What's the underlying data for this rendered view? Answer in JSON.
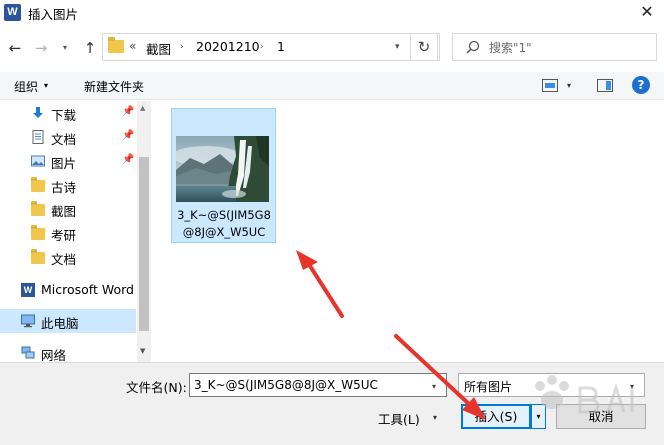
{
  "window": {
    "app_icon_letter": "W",
    "title": "插入图片",
    "close_glyph": "✕"
  },
  "navigation": {
    "back_glyph": "←",
    "forward_glyph": "→",
    "recent_glyph": "▾",
    "up_glyph": "↑",
    "breadcrumb_overflow": "«",
    "breadcrumbs": [
      "截图",
      "20201210",
      "1"
    ],
    "separator": "›",
    "refresh_glyph": "↻",
    "search_placeholder": "搜索\"1\""
  },
  "toolbar": {
    "organize_label": "组织",
    "organize_arrow": "▾",
    "new_folder_label": "新建文件夹",
    "view_arrow": "▾",
    "help_glyph": "?"
  },
  "sidebar": {
    "pin_glyph": "📌",
    "items": [
      {
        "label": "下载",
        "icon": "download-icon",
        "pinned": true
      },
      {
        "label": "文档",
        "icon": "document-icon",
        "pinned": true
      },
      {
        "label": "图片",
        "icon": "pictures-icon",
        "pinned": true
      },
      {
        "label": "古诗",
        "icon": "folder-icon",
        "pinned": false
      },
      {
        "label": "截图",
        "icon": "folder-icon",
        "pinned": false
      },
      {
        "label": "考研",
        "icon": "folder-icon",
        "pinned": false
      },
      {
        "label": "文档",
        "icon": "folder-icon",
        "pinned": false
      },
      {
        "label": "Microsoft Word",
        "icon": "word-icon",
        "pinned": false
      },
      {
        "label": "此电脑",
        "icon": "computer-icon",
        "pinned": false,
        "selected": true
      },
      {
        "label": "网络",
        "icon": "network-icon",
        "pinned": false
      }
    ]
  },
  "files": [
    {
      "name": "3_K~@S(JIM5G8@8J@X_W5UC",
      "thumbnail": "waterfall-landscape",
      "selected": true
    }
  ],
  "footer": {
    "filename_label": "文件名(N):",
    "filename_value": "3_K~@S(JIM5G8@8J@X_W5UC",
    "filter_value": "所有图片",
    "tools_label": "工具(L)",
    "insert_label": "插入(S)",
    "cancel_label": "取消",
    "dropdown_arrow": "▾"
  },
  "colors": {
    "selection": "#cce8ff",
    "accent": "#0078d7",
    "annotation_arrow": "#e8352b",
    "folder": "#f0c74a"
  }
}
